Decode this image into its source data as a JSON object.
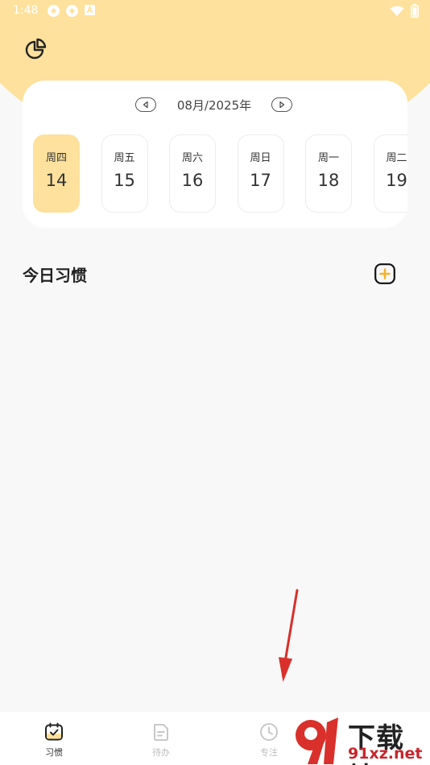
{
  "status_bar": {
    "time": "1:48",
    "icons_left": [
      "app-notification-icon",
      "app-notification-icon",
      "font-notification-icon"
    ],
    "icons_right": [
      "wifi-icon",
      "battery-icon"
    ]
  },
  "calendar": {
    "month_label": "08月/2025年",
    "days": [
      {
        "week": "周四",
        "date": "14",
        "active": true
      },
      {
        "week": "周五",
        "date": "15",
        "active": false
      },
      {
        "week": "周六",
        "date": "16",
        "active": false
      },
      {
        "week": "周日",
        "date": "17",
        "active": false
      },
      {
        "week": "周一",
        "date": "18",
        "active": false
      },
      {
        "week": "周二",
        "date": "19",
        "active": false
      }
    ]
  },
  "section": {
    "title": "今日习惯"
  },
  "bottom_nav": {
    "items": [
      {
        "label": "习惯",
        "icon": "habit-calendar-icon",
        "active": true
      },
      {
        "label": "待办",
        "icon": "todo-doc-icon",
        "active": false
      },
      {
        "label": "专注",
        "icon": "clock-icon",
        "active": false
      }
    ]
  },
  "watermark": {
    "top": "下载站",
    "bottom": "91xz.net"
  },
  "colors": {
    "accent": "#fde19c",
    "add_icon": "#f5b32a",
    "annotation": "#d9302b"
  }
}
